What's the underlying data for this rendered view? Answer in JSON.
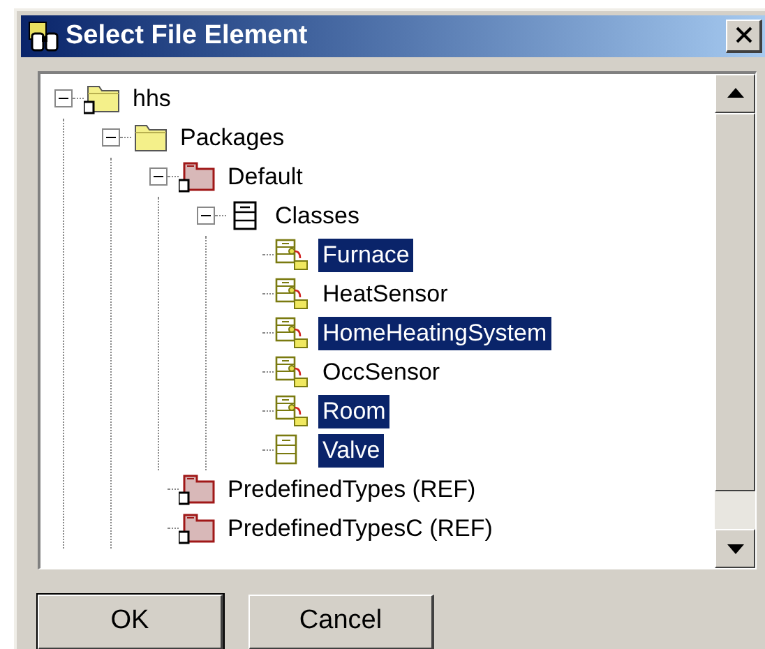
{
  "window": {
    "title": "Select File Element"
  },
  "tree": [
    {
      "label": "hhs",
      "kind": "folder",
      "locked": true,
      "expanded": true,
      "children": [
        {
          "label": "Packages",
          "kind": "folder",
          "locked": false,
          "expanded": true,
          "children": [
            {
              "label": "Default",
              "kind": "package",
              "locked": true,
              "expanded": true,
              "children": [
                {
                  "label": "Classes",
                  "kind": "group",
                  "expanded": true,
                  "children": [
                    {
                      "label": "Furnace",
                      "kind": "class",
                      "selected": true
                    },
                    {
                      "label": "HeatSensor",
                      "kind": "class",
                      "selected": false
                    },
                    {
                      "label": "HomeHeatingSystem",
                      "kind": "class",
                      "selected": true
                    },
                    {
                      "label": "OccSensor",
                      "kind": "class",
                      "selected": false
                    },
                    {
                      "label": "Room",
                      "kind": "class",
                      "selected": true
                    },
                    {
                      "label": "Valve",
                      "kind": "record",
                      "selected": true
                    }
                  ]
                }
              ]
            },
            {
              "label": "PredefinedTypes (REF)",
              "kind": "package",
              "locked": true,
              "expanded": false
            },
            {
              "label": "PredefinedTypesC (REF)",
              "kind": "package",
              "locked": true,
              "expanded": false
            }
          ]
        }
      ]
    }
  ],
  "buttons": [
    {
      "label": "OK",
      "default": true
    },
    {
      "label": "Cancel",
      "default": false
    }
  ]
}
